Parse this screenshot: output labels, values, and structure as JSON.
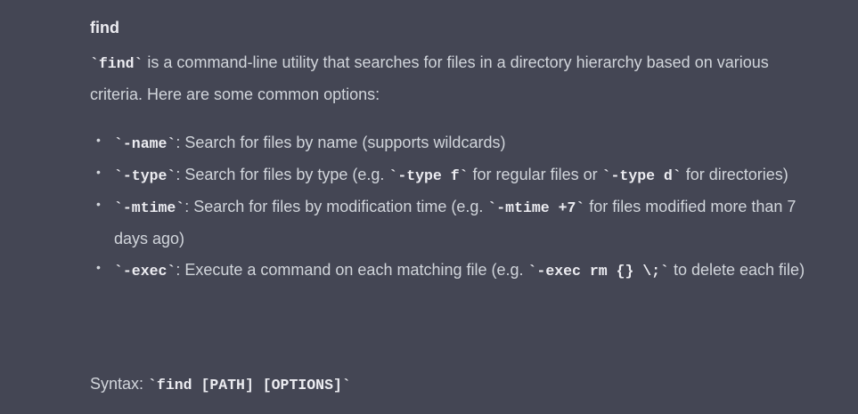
{
  "heading": "find",
  "intro": {
    "code": "`find`",
    "text": " is a command-line utility that searches for files in a directory hierarchy based on various criteria. Here are some common options:"
  },
  "options": [
    {
      "code": "`-name`",
      "text1": ": Search for files by name (supports wildcards)"
    },
    {
      "code": "`-type`",
      "text1": ": Search for files by type (e.g. ",
      "code2": "`-type f`",
      "text2": " for regular files or ",
      "code3": "`-type d`",
      "text3": " for directories)"
    },
    {
      "code": "`-mtime`",
      "text1": ": Search for files by modification time (e.g. ",
      "code2": "`-mtime +7`",
      "text2": " for files modified more than 7 days ago)"
    },
    {
      "code": "`-exec`",
      "text1": ": Execute a command on each matching file (e.g. ",
      "code2": "`-exec rm {} \\;`",
      "text2": " to delete each file)"
    }
  ],
  "syntax": {
    "label": "Syntax: ",
    "code": "`find [PATH] [OPTIONS]`"
  },
  "colors": {
    "background": "#444654",
    "text": "#d1d5db",
    "emphasis": "#ececf1"
  },
  "icons": {
    "bullet": "bullet-dot-icon"
  }
}
